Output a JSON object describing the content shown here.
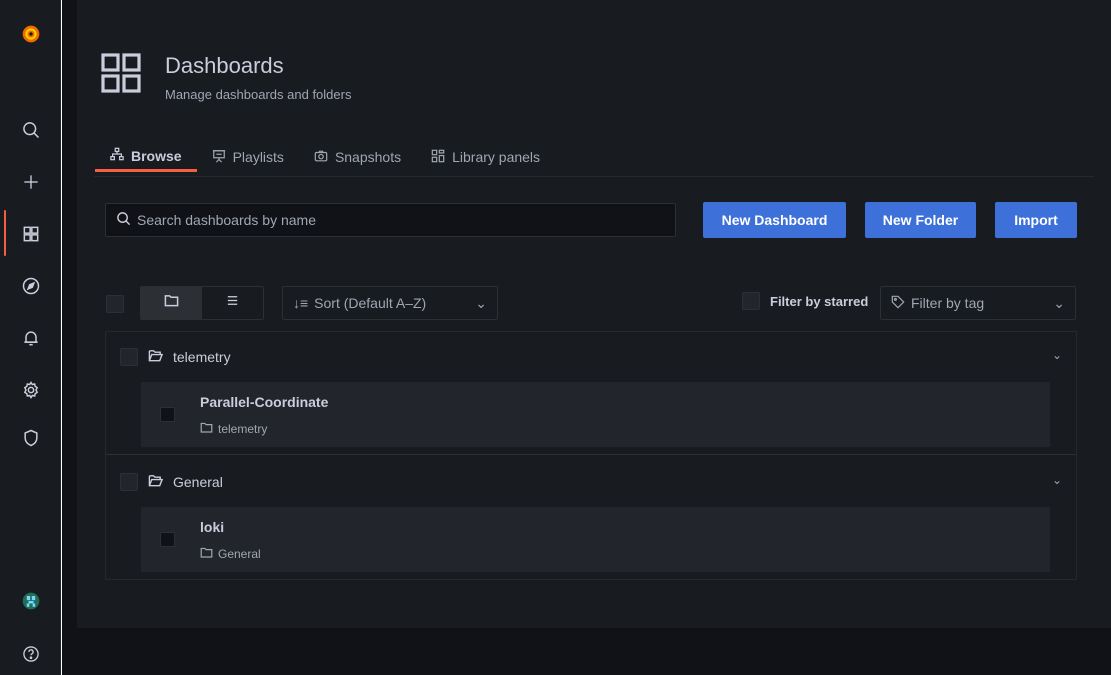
{
  "header": {
    "title": "Dashboards",
    "subtitle": "Manage dashboards and folders",
    "icon": "apps-grid-icon"
  },
  "sidebar": {
    "items": [
      {
        "name": "grafana-logo",
        "icon": "grafana-logo"
      },
      {
        "name": "search",
        "icon": "search-icon"
      },
      {
        "name": "create",
        "icon": "plus-icon"
      },
      {
        "name": "dashboards",
        "icon": "apps-grid-icon",
        "active": true
      },
      {
        "name": "explore",
        "icon": "compass-icon"
      },
      {
        "name": "alerting",
        "icon": "bell-icon"
      },
      {
        "name": "configuration",
        "icon": "gear-icon"
      },
      {
        "name": "server-admin",
        "icon": "shield-icon"
      },
      {
        "name": "user",
        "icon": "avatar"
      },
      {
        "name": "help",
        "icon": "question-circle-icon"
      }
    ]
  },
  "tabs": [
    {
      "label": "Browse",
      "icon": "sitemap-icon",
      "active": true
    },
    {
      "label": "Playlists",
      "icon": "presentation-icon"
    },
    {
      "label": "Snapshots",
      "icon": "camera-icon"
    },
    {
      "label": "Library panels",
      "icon": "library-panels-icon"
    }
  ],
  "toolbar": {
    "search_placeholder": "Search dashboards by name",
    "new_dashboard": "New Dashboard",
    "new_folder": "New Folder",
    "import": "Import"
  },
  "filters": {
    "sort": "Sort (Default A–Z)",
    "starred": "Filter by starred",
    "tag": "Filter by tag"
  },
  "folders": [
    {
      "name": "telemetry",
      "dashboards": [
        {
          "title": "Parallel-Coordinate",
          "folder": "telemetry"
        }
      ]
    },
    {
      "name": "General",
      "dashboards": [
        {
          "title": "loki",
          "folder": "General"
        }
      ]
    }
  ],
  "colors": {
    "accent": "#f55f3e",
    "primary_button": "#3d71d9",
    "background": "#111217",
    "panel": "#181b1f"
  }
}
